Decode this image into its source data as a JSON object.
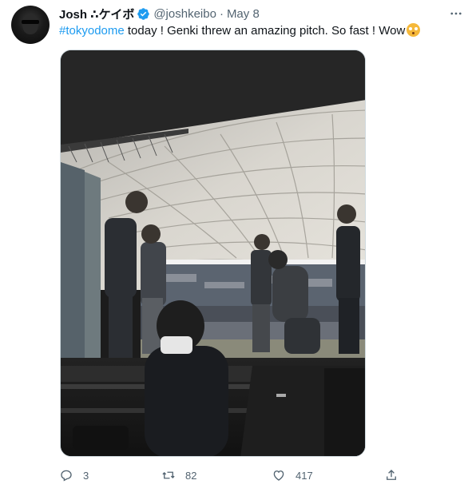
{
  "tweet": {
    "author_name": "Josh ∴ケイボ",
    "handle": "@joshkeibo",
    "separator": "·",
    "time": "May 8",
    "hashtag": "#tokyodome",
    "body": " today ! Genki threw an amazing pitch. So fast ! Wow",
    "emoji": "flushed-face-emoji",
    "photo_alt": "Photo of players and staff walking out of the dugout at Tokyo Dome under the white dome roof"
  },
  "actions": {
    "reply_count": "3",
    "retweet_count": "82",
    "like_count": "417"
  },
  "icons": [
    "verified-badge-icon",
    "more-icon",
    "reply-icon",
    "retweet-icon",
    "like-icon",
    "share-icon"
  ],
  "colors": {
    "accent": "#1d9bf0",
    "secondary_text": "#536471",
    "text": "#0f1419"
  }
}
